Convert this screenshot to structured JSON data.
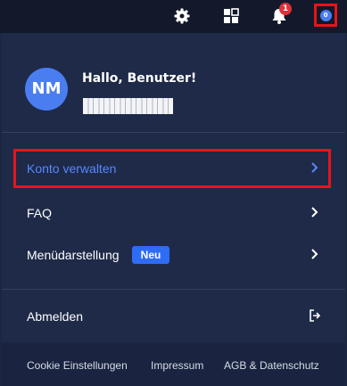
{
  "topbar": {
    "notification_count": "1",
    "avatar_initials": "0"
  },
  "profile": {
    "initials": "NM",
    "greeting": "Hallo, Benutzer!"
  },
  "menu": {
    "items": [
      {
        "label": "Konto verwalten"
      },
      {
        "label": "FAQ"
      },
      {
        "label": "Menüdarstellung",
        "badge": "Neu"
      },
      {
        "label": "Abmelden"
      }
    ]
  },
  "footer": {
    "links": [
      "Cookie Einstellungen",
      "Impressum",
      "AGB & Datenschutz"
    ]
  },
  "colors": {
    "accent": "#4a7df0",
    "highlight": "#e8131a",
    "badge": "#2f6cf5"
  }
}
